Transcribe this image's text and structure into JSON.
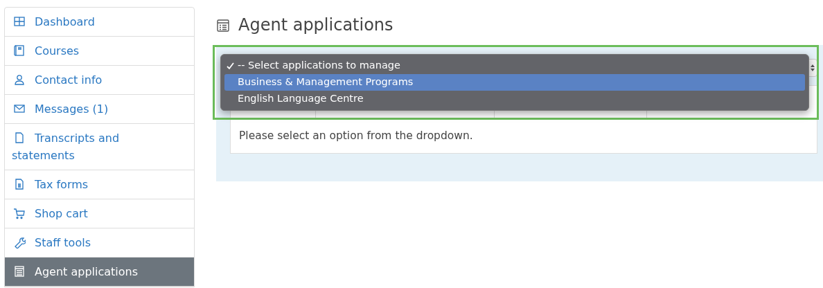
{
  "sidebar": {
    "items": [
      {
        "label": "Dashboard",
        "selected": false
      },
      {
        "label": "Courses",
        "selected": false
      },
      {
        "label": "Contact info",
        "selected": false
      },
      {
        "label": "Messages (1)",
        "selected": false
      },
      {
        "label": "Transcripts and statements",
        "selected": false
      },
      {
        "label": "Tax forms",
        "selected": false
      },
      {
        "label": "Shop cart",
        "selected": false
      },
      {
        "label": "Staff tools",
        "selected": false
      },
      {
        "label": "Agent applications",
        "selected": true
      }
    ]
  },
  "page": {
    "title": "Agent applications",
    "dropdown": {
      "options": [
        {
          "label": "-- Select applications to manage",
          "checked": true,
          "highlighted": false
        },
        {
          "label": "Business & Management Programs",
          "checked": false,
          "highlighted": true
        },
        {
          "label": "English Language Centre",
          "checked": false,
          "highlighted": false
        }
      ]
    },
    "table": {
      "message": "Please select an option from the dropdown."
    }
  }
}
